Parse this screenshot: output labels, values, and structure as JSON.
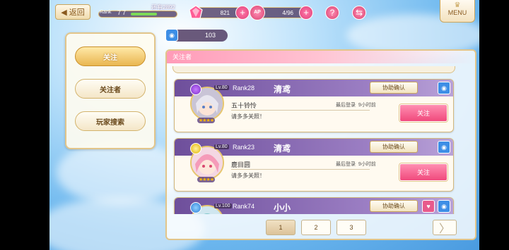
{
  "topbar": {
    "back_label": "返回",
    "rank_label": "Rank",
    "rank_value": "77",
    "rank_remaining": "还有2892",
    "rank_progress": 0.6,
    "gems": "821",
    "ap_label": "AP",
    "ap": "4/96",
    "help_icon": "question-icon",
    "menu_label": "MENU"
  },
  "sidebar": {
    "items": [
      {
        "label": "关注",
        "active": true
      },
      {
        "label": "关注者",
        "active": false
      },
      {
        "label": "玩家搜索",
        "active": false
      }
    ]
  },
  "follower_count": "103",
  "panel": {
    "title": "关注者",
    "assist_label": "协助确认",
    "follow_label": "关注",
    "last_login_label": "最后登录",
    "cards": [
      {
        "rank": "Rank28",
        "name": "清鸢",
        "level": "Lv.80",
        "unit": "五十铃怜",
        "comment": "请多多关照！",
        "last_login": "9小时前",
        "stars": "★★★★"
      },
      {
        "rank": "Rank23",
        "name": "清鸢",
        "level": "Lv.80",
        "unit": "鹿目圆",
        "comment": "请多多关照！",
        "last_login": "9小时前",
        "stars": "★★★★"
      },
      {
        "rank": "Rank74",
        "name": "小小",
        "level": "Lv.100",
        "unit": "",
        "comment": "",
        "last_login": "",
        "stars": ""
      }
    ]
  },
  "pagination": {
    "pages": [
      "1",
      "2",
      "3"
    ],
    "current": "1",
    "next_glyph": "〉"
  },
  "colors": {
    "accent_pink": "#f0497c",
    "header_purple": "#6e4f9b",
    "gold_border": "#e2c58a"
  }
}
